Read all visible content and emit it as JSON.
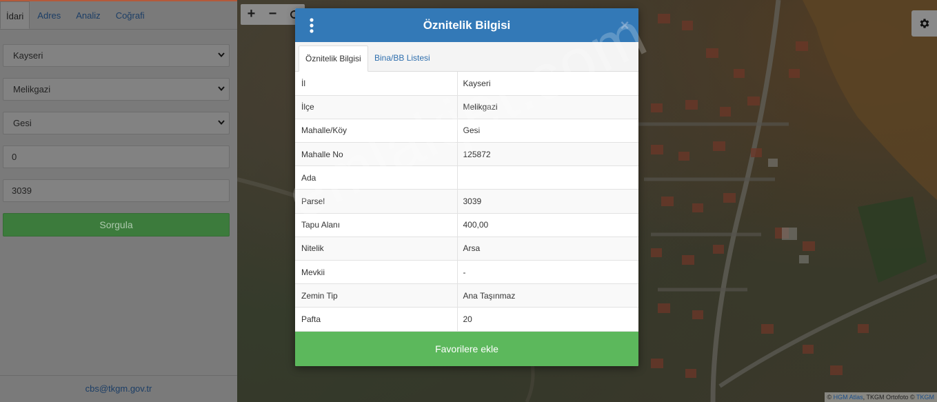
{
  "sidebar": {
    "tabs": [
      "İdari",
      "Adres",
      "Analiz",
      "Coğrafi"
    ],
    "active_tab": "İdari",
    "il_select": "Kayseri",
    "ilce_select": "Melikgazi",
    "mahalle_select": "Gesi",
    "ada_value": "0",
    "parsel_value": "3039",
    "query_button": "Sorgula",
    "footer_email": "cbs@tkgm.gov.tr"
  },
  "map": {
    "zoom_in": "+",
    "zoom_out": "−",
    "attribution": {
      "prefix": "©",
      "hgm": "HGM Atlas",
      "middle": ", TKGM Ortofoto ©",
      "tkgm": "TKGM"
    }
  },
  "modal": {
    "title": "Öznitelik Bilgisi",
    "close": "×",
    "tabs": [
      "Öznitelik Bilgisi",
      "Bina/BB Listesi"
    ],
    "rows": [
      {
        "key": "İl",
        "value": "Kayseri"
      },
      {
        "key": "İlçe",
        "value": "Melikgazi"
      },
      {
        "key": "Mahalle/Köy",
        "value": "Gesi"
      },
      {
        "key": "Mahalle No",
        "value": "125872"
      },
      {
        "key": "Ada",
        "value": ""
      },
      {
        "key": "Parsel",
        "value": "3039"
      },
      {
        "key": "Tapu Alanı",
        "value": "400,00"
      },
      {
        "key": "Nitelik",
        "value": "Arsa"
      },
      {
        "key": "Mevkii",
        "value": "-"
      },
      {
        "key": "Zemin Tip",
        "value": "Ana Taşınmaz"
      },
      {
        "key": "Pafta",
        "value": "20"
      }
    ],
    "favorite_button": "Favorilere ekle"
  },
  "watermark": "emlakjet.com",
  "colors": {
    "header_blue": "#3379b7",
    "favorite_green": "#5cb85c",
    "query_green": "#3c7b3c",
    "tab_link_blue": "#2f6fae"
  },
  "icons": {
    "modal_menu": "kebab-menu-icon",
    "settings": "gear-icon",
    "select_arrow": "chevron-down-icon",
    "refresh": "refresh-icon"
  }
}
